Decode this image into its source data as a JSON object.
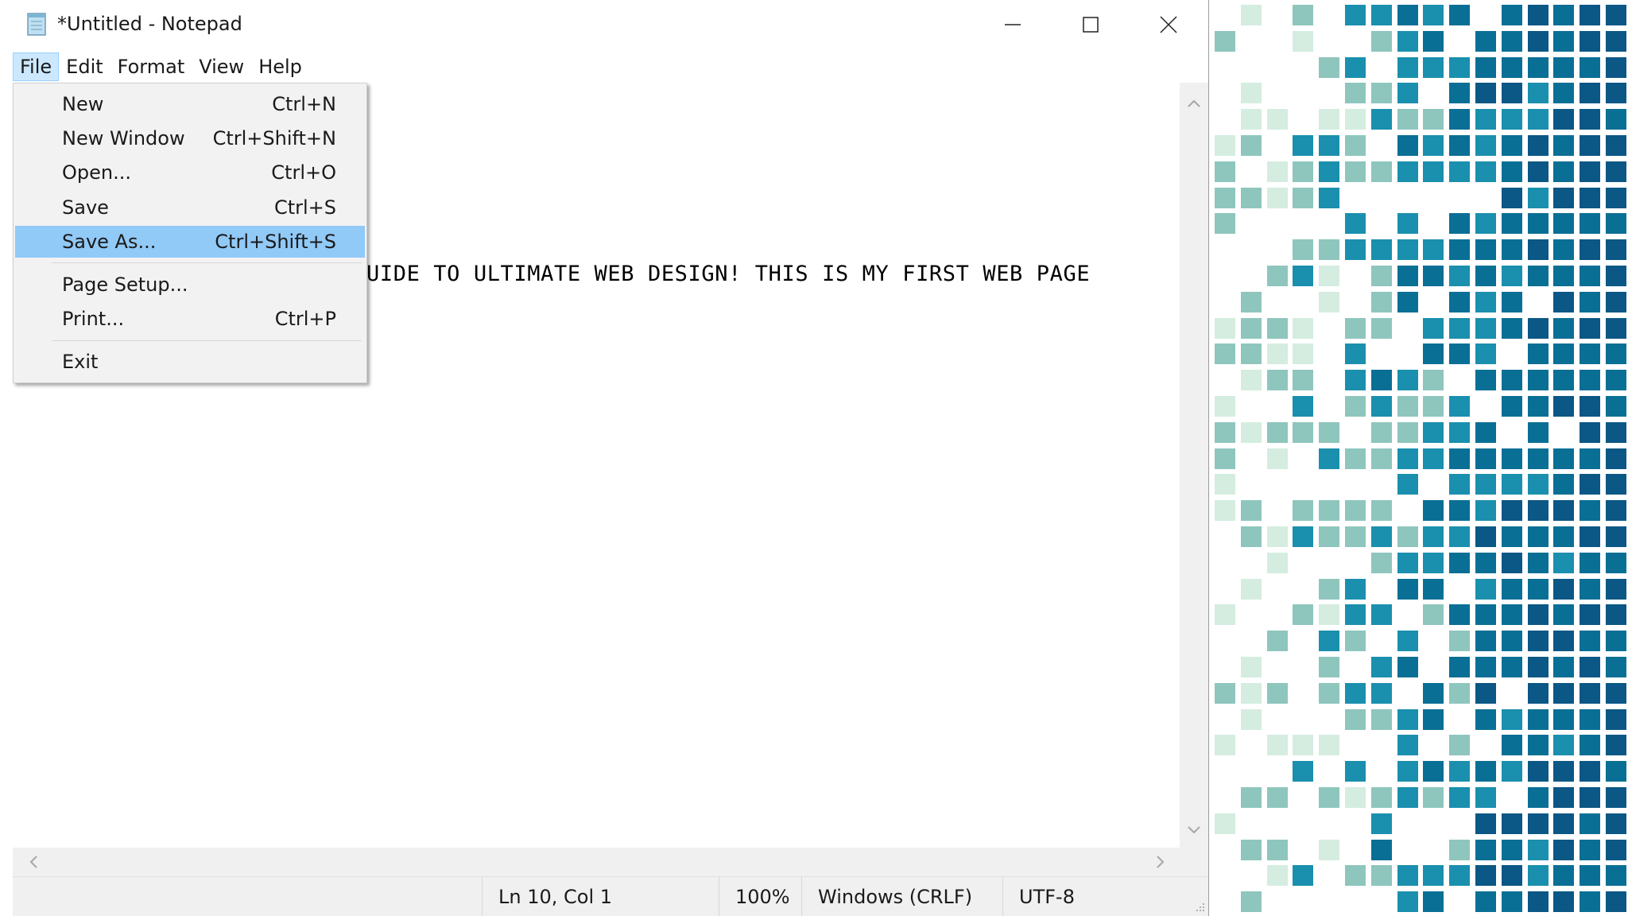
{
  "window": {
    "title": "*Untitled - Notepad"
  },
  "menubar": [
    "File",
    "Edit",
    "Format",
    "View",
    "Help"
  ],
  "file_menu": {
    "items": [
      {
        "label": "New",
        "shortcut": "Ctrl+N"
      },
      {
        "label": "New Window",
        "shortcut": "Ctrl+Shift+N"
      },
      {
        "label": "Open...",
        "shortcut": "Ctrl+O"
      },
      {
        "label": "Save",
        "shortcut": "Ctrl+S"
      },
      {
        "label": "Save As...",
        "shortcut": "Ctrl+Shift+S",
        "highlighted": true
      },
      {
        "label": "Page Setup...",
        "shortcut": ""
      },
      {
        "label": "Print...",
        "shortcut": "Ctrl+P"
      },
      {
        "label": "Exit",
        "shortcut": ""
      }
    ]
  },
  "editor": {
    "visible_text": "UIDE TO ULTIMATE WEB DESIGN! THIS IS MY FIRST WEB PAGE"
  },
  "statusbar": {
    "position": "Ln 10, Col 1",
    "zoom": "100%",
    "line_ending": "Windows (CRLF)",
    "encoding": "UTF-8"
  },
  "colors": {
    "menu_active": "#cce8ff",
    "menu_highlight": "#91c9f7",
    "mosaic_palette": [
      "#d4ede0",
      "#8ec6bd",
      "#1a8fae",
      "#0a6f95",
      "#0b5785"
    ]
  },
  "icons": {
    "app": "notepad-icon",
    "minimize": "minimize-icon",
    "maximize": "maximize-icon",
    "close": "close-icon"
  }
}
